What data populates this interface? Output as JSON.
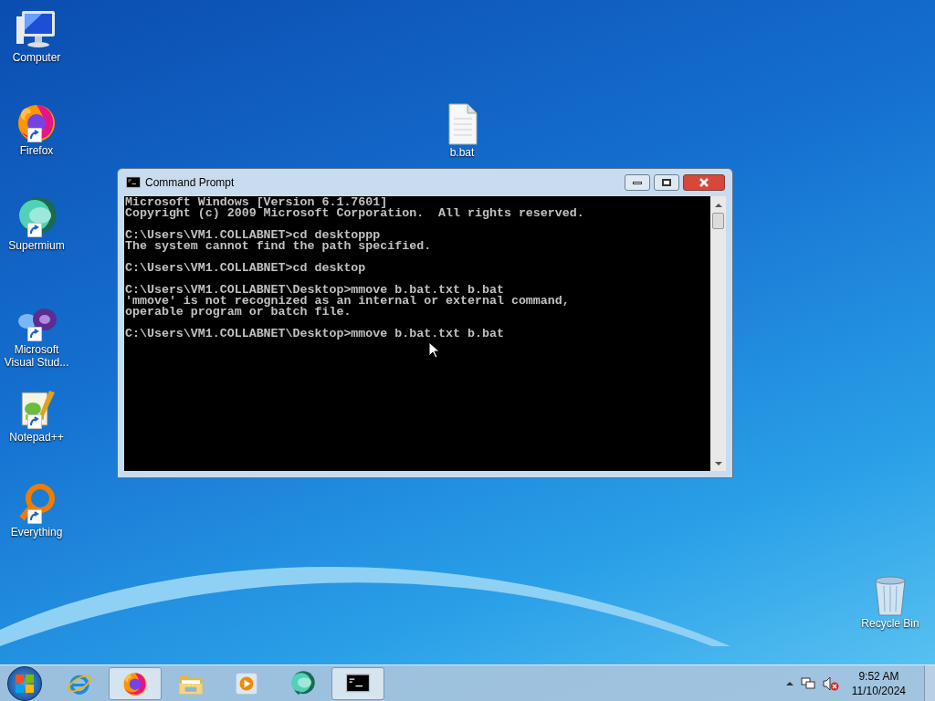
{
  "desktop_icons": [
    {
      "label": "Computer",
      "kind": "computer",
      "shortcut": false
    },
    {
      "label": "Firefox",
      "kind": "firefox",
      "shortcut": true
    },
    {
      "label": "Supermium",
      "kind": "supermium",
      "shortcut": true
    },
    {
      "label": "Microsoft Visual Stud...",
      "kind": "vs",
      "shortcut": true
    },
    {
      "label": "Notepad++",
      "kind": "notepad",
      "shortcut": true
    },
    {
      "label": "Everything",
      "kind": "everything",
      "shortcut": true
    },
    {
      "label": "b.bat",
      "kind": "file",
      "shortcut": false
    },
    {
      "label": "Recycle Bin",
      "kind": "recycle",
      "shortcut": false
    }
  ],
  "window": {
    "title": "Command Prompt",
    "console": [
      [
        "Microsoft Windows [Version 6.1.7601]",
        "Copyright (c) 2009 Microsoft Corporation.  All rights reserved."
      ],
      [
        "C:\\Users\\VM1.COLLABNET>cd desktoppp",
        "The system cannot find the path specified."
      ],
      [
        "C:\\Users\\VM1.COLLABNET>cd desktop"
      ],
      [
        "C:\\Users\\VM1.COLLABNET\\Desktop>mmove b.bat.txt b.bat",
        "'mmove' is not recognized as an internal or external command,",
        "operable program or batch file."
      ],
      [
        "C:\\Users\\VM1.COLLABNET\\Desktop>mmove b.bat.txt b.bat"
      ]
    ]
  },
  "taskbar": {
    "items": [
      {
        "kind": "ie",
        "selected": false
      },
      {
        "kind": "firefox",
        "selected": true
      },
      {
        "kind": "folder",
        "selected": false
      },
      {
        "kind": "media",
        "selected": false
      },
      {
        "kind": "supermium",
        "selected": false
      },
      {
        "kind": "cmd",
        "selected": true
      }
    ],
    "time": "9:52 AM",
    "date": "11/10/2024"
  }
}
